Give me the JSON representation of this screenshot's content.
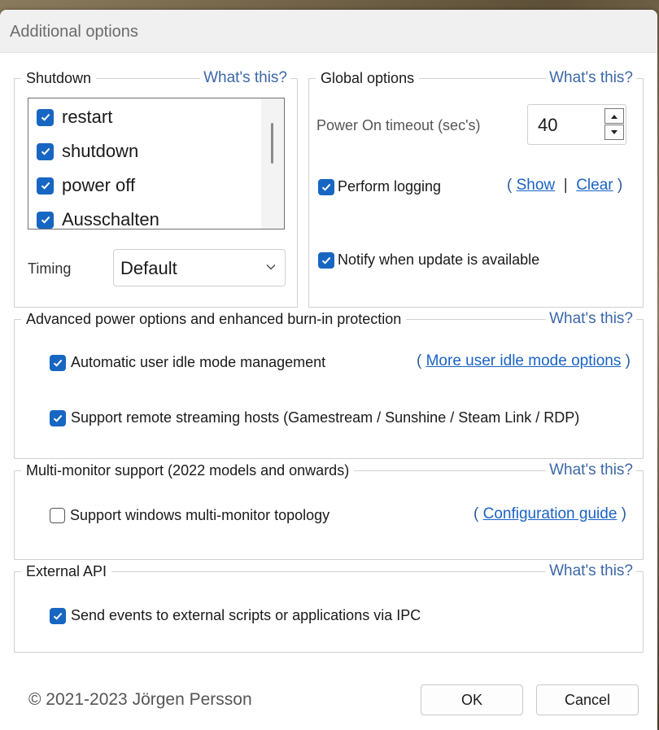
{
  "window": {
    "title": "Additional options"
  },
  "shutdown": {
    "legend": "Shutdown",
    "whats_this": "What's this?",
    "items": [
      {
        "label": "restart",
        "checked": true
      },
      {
        "label": "shutdown",
        "checked": true
      },
      {
        "label": "power off",
        "checked": true
      },
      {
        "label": "Ausschalten",
        "checked": true
      }
    ],
    "timing_label": "Timing",
    "timing_value": "Default"
  },
  "global": {
    "legend": "Global options",
    "whats_this": "What's this?",
    "power_on_label": "Power On timeout (sec's)",
    "power_on_value": "40",
    "logging_label": "Perform logging",
    "logging_checked": true,
    "show_link": "Show",
    "clear_link": "Clear",
    "notify_label": "Notify when update is available",
    "notify_checked": true
  },
  "advanced": {
    "legend": "Advanced power options and enhanced burn-in protection",
    "whats_this": "What's this?",
    "idle_label": "Automatic user idle mode management",
    "idle_checked": true,
    "idle_link": "More user idle mode options",
    "streaming_label": "Support remote streaming hosts (Gamestream / Sunshine / Steam Link / RDP)",
    "streaming_checked": true
  },
  "multimonitor": {
    "legend": "Multi-monitor support (2022 models and onwards)",
    "whats_this": "What's this?",
    "topology_label": "Support windows multi-monitor topology",
    "topology_checked": false,
    "guide_link": "Configuration guide"
  },
  "external": {
    "legend": "External API",
    "whats_this": "What's this?",
    "ipc_label": "Send events to external scripts or applications via IPC",
    "ipc_checked": true
  },
  "footer": {
    "copyright": "© 2021-2023 Jörgen Persson",
    "ok": "OK",
    "cancel": "Cancel"
  },
  "colors": {
    "accent": "#1766c2",
    "link": "#1a63c5",
    "whats_this": "#3c68a8"
  },
  "icons": {
    "check": "check-icon",
    "chevron": "chevron-down-icon",
    "spin_up": "arrow-up-icon",
    "spin_down": "arrow-down-icon"
  }
}
